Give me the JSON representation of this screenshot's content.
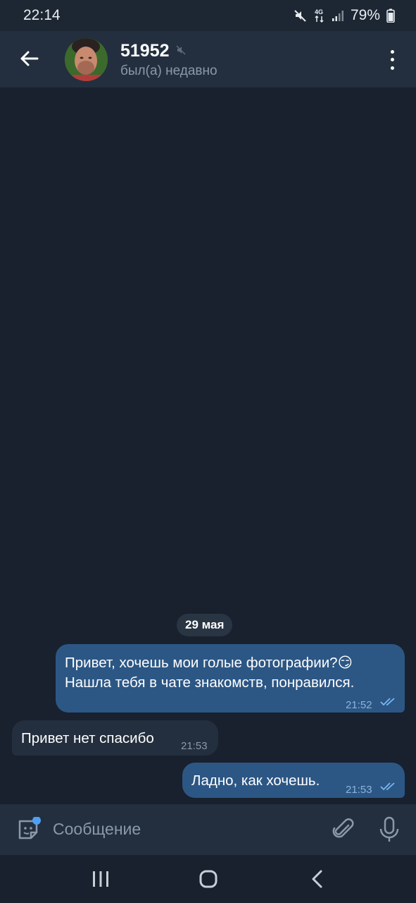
{
  "status_bar": {
    "time": "22:14",
    "battery": "79%",
    "network": "4G",
    "icons": [
      "mute-icon",
      "network-4g-icon",
      "signal-icon",
      "battery-icon"
    ]
  },
  "header": {
    "contact_name": "51952",
    "contact_status": "был(а) недавно",
    "icons": [
      "back-arrow-icon",
      "muted-speaker-icon",
      "more-vertical-icon"
    ]
  },
  "chat": {
    "date_label": "29 мая",
    "messages": [
      {
        "direction": "outgoing",
        "lines": [
          "Привет, хочешь мои голые фотографии?😏",
          "Нашла тебя в чате знакомств, понравился."
        ],
        "time": "21:52",
        "read": true
      },
      {
        "direction": "incoming",
        "text": "Привет нет спасибо",
        "time": "21:53"
      },
      {
        "direction": "outgoing",
        "text": "Ладно, как хочешь.",
        "time": "21:53",
        "read": true
      }
    ]
  },
  "composer": {
    "placeholder": "Сообщение",
    "icons": [
      "sticker-icon",
      "paperclip-icon",
      "microphone-icon"
    ]
  },
  "navbar": {
    "icons": [
      "recent-apps-icon",
      "home-icon",
      "back-icon"
    ]
  },
  "colors": {
    "background": "#18212d",
    "header": "#232f3e",
    "outgoing_bubble": "#2c5785",
    "incoming_bubble": "#232f3e",
    "accent": "#5aa8ff"
  }
}
